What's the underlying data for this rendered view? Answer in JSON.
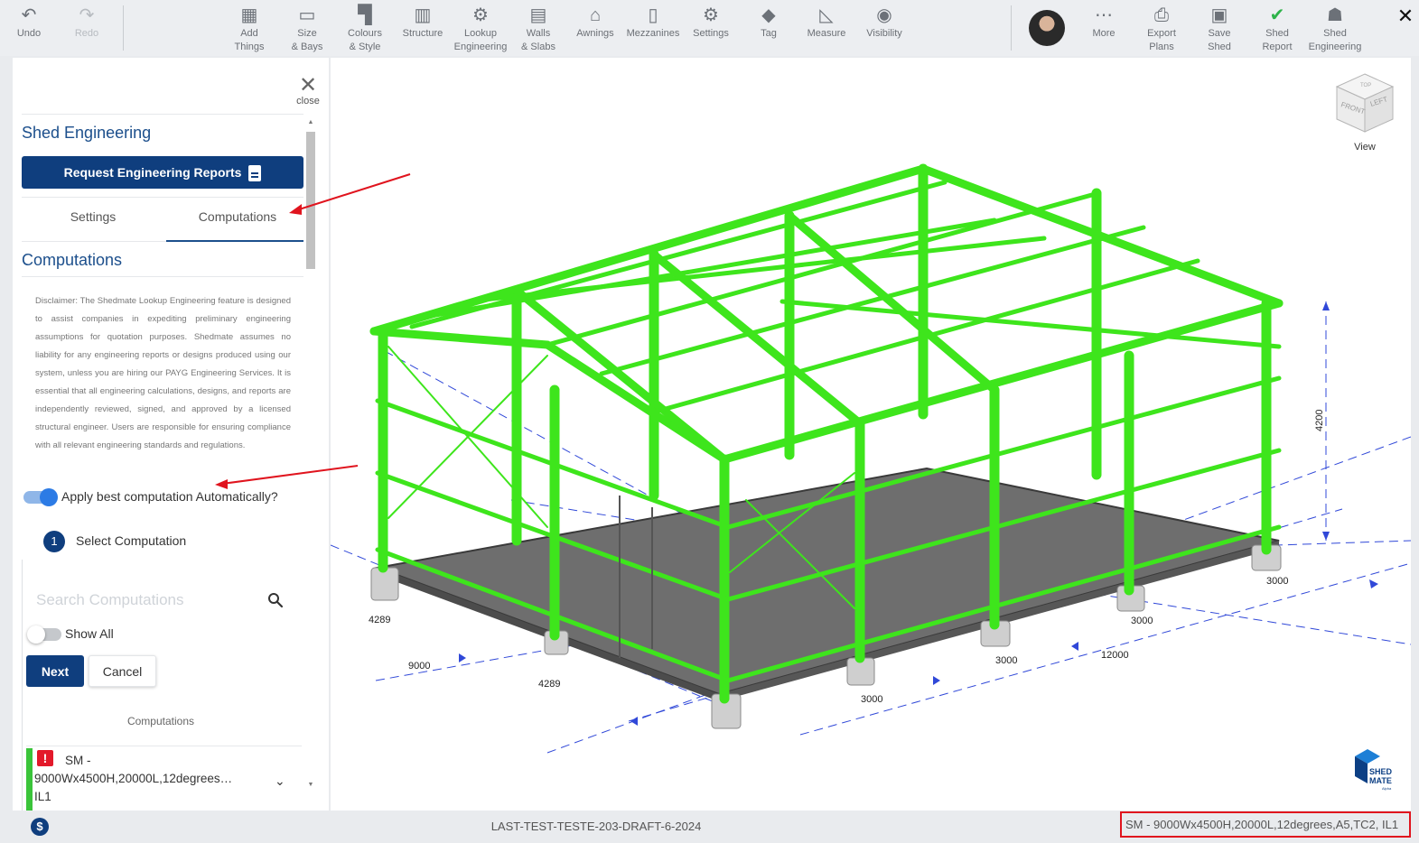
{
  "toolbar": {
    "left": [
      {
        "label": "Undo",
        "icon": "undo-icon"
      },
      {
        "label": "Redo",
        "icon": "redo-icon"
      }
    ],
    "main": [
      {
        "l1": "Add",
        "l2": "Things",
        "icon": "add-things-icon"
      },
      {
        "l1": "Size",
        "l2": "& Bays",
        "icon": "ruler-icon"
      },
      {
        "l1": "Colours",
        "l2": "& Style",
        "icon": "paint-roller-icon"
      },
      {
        "l1": "Structure",
        "l2": "",
        "icon": "structure-icon"
      },
      {
        "l1": "Lookup",
        "l2": "Engineering",
        "icon": "engineering-icon"
      },
      {
        "l1": "Walls",
        "l2": "& Slabs",
        "icon": "walls-icon"
      },
      {
        "l1": "Awnings",
        "l2": "",
        "icon": "awning-icon"
      },
      {
        "l1": "Mezzanines",
        "l2": "",
        "icon": "mezzanine-icon"
      },
      {
        "l1": "Settings",
        "l2": "",
        "icon": "gear-icon"
      },
      {
        "l1": "Tag",
        "l2": "",
        "icon": "tag-icon"
      },
      {
        "l1": "Measure",
        "l2": "",
        "icon": "measure-icon"
      },
      {
        "l1": "Visibility",
        "l2": "",
        "icon": "eye-icon"
      }
    ],
    "right": [
      {
        "l1": "More",
        "l2": "",
        "icon": "more-dots-icon"
      },
      {
        "l1": "Export",
        "l2": "Plans",
        "icon": "printer-icon"
      },
      {
        "l1": "Save",
        "l2": "Shed",
        "icon": "save-icon"
      },
      {
        "l1": "Shed",
        "l2": "Report",
        "icon": "check-circle-icon"
      },
      {
        "l1": "Shed",
        "l2": "Engineering",
        "icon": "user-gear-icon"
      }
    ]
  },
  "panel": {
    "close_label": "close",
    "title": "Shed Engineering",
    "request_button": "Request Engineering Reports",
    "tabs": [
      "Settings",
      "Computations"
    ],
    "active_tab": "Computations",
    "section_title": "Computations",
    "disclaimer": "Disclaimer: The Shedmate Lookup Engineering feature is designed to assist companies in expediting preliminary engineering assumptions for quotation purposes. Shedmate assumes no liability for any engineering reports or designs produced using our system, unless you are hiring our PAYG Engineering Services. It is essential that all engineering calculations, designs, and reports are independently reviewed, signed, and approved by a licensed structural engineer. Users are responsible for ensuring compliance with all relevant engineering standards and regulations.",
    "auto_toggle_label": "Apply best computation Automatically?",
    "auto_toggle_on": true,
    "step_number": "1",
    "step_label": "Select Computation",
    "search_placeholder": "Search Computations",
    "show_all_label": "Show All",
    "show_all_on": false,
    "next_button": "Next",
    "cancel_button": "Cancel",
    "computations_header": "Computations",
    "computation_item": "SM - 9000Wx4500H,20000L,12degrees… IL1"
  },
  "viewport": {
    "view_label": "View",
    "cube_faces": [
      "TOP",
      "FRONT",
      "LEFT"
    ],
    "dimensions": [
      "4289",
      "9000",
      "4289",
      "3000",
      "3000",
      "3000",
      "12000",
      "3000",
      "3000",
      "4200"
    ],
    "logo_text": [
      "SHED",
      "MATE",
      "Alpha"
    ]
  },
  "status": {
    "file_name": "LAST-TEST-TESTE-203-DRAFT-6-2024",
    "shed_code": "SM - 9000Wx4500H,20000L,12degrees,A5,TC2, IL1"
  },
  "colors": {
    "primary": "#0f3e7e",
    "accent_blue": "#1c4f8c",
    "steel_green": "#3ee51c",
    "highlight_red": "#e0141e",
    "valid_green": "#3ac43a"
  }
}
